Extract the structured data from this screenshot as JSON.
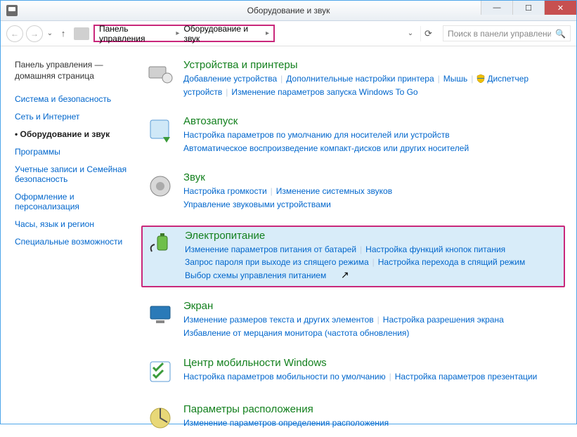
{
  "window": {
    "title": "Оборудование и звук",
    "search_placeholder": "Поиск в панели управления"
  },
  "breadcrumb": {
    "root": "Панель управления",
    "current": "Оборудование и звук"
  },
  "sidebar": {
    "home": "Панель управления — домашняя страница",
    "items": [
      {
        "label": "Система и безопасность",
        "current": false
      },
      {
        "label": "Сеть и Интернет",
        "current": false
      },
      {
        "label": "Оборудование и звук",
        "current": true
      },
      {
        "label": "Программы",
        "current": false
      },
      {
        "label": "Учетные записи и Семейная безопасность",
        "current": false
      },
      {
        "label": "Оформление и персонализация",
        "current": false
      },
      {
        "label": "Часы, язык и регион",
        "current": false
      },
      {
        "label": "Специальные возможности",
        "current": false
      }
    ]
  },
  "categories": [
    {
      "title": "Устройства и принтеры",
      "links": [
        "Добавление устройства",
        "Дополнительные настройки принтера",
        "Мышь",
        "_shield_Диспетчер устройств",
        "Изменение параметров запуска Windows To Go"
      ]
    },
    {
      "title": "Автозапуск",
      "links": [
        "Настройка параметров по умолчанию для носителей или устройств",
        "_br_Автоматическое воспроизведение компакт-дисков или других носителей"
      ]
    },
    {
      "title": "Звук",
      "links": [
        "Настройка громкости",
        "Изменение системных звуков",
        "_br_Управление звуковыми устройствами"
      ]
    },
    {
      "title": "Электропитание",
      "highlighted": true,
      "links": [
        "Изменение параметров питания от батарей",
        "Настройка функций кнопок питания",
        "_br_Запрос пароля при выходе из спящего режима",
        "Настройка перехода в спящий режим",
        "_br_Выбор схемы управления питанием"
      ]
    },
    {
      "title": "Экран",
      "links": [
        "Изменение размеров текста и других элементов",
        "Настройка разрешения экрана",
        "_br_Избавление от мерцания монитора (частота обновления)"
      ]
    },
    {
      "title": "Центр мобильности Windows",
      "links": [
        "Настройка параметров мобильности по умолчанию",
        "Настройка параметров презентации"
      ]
    },
    {
      "title": "Параметры расположения",
      "links": [
        "Изменение параметров определения расположения"
      ]
    }
  ]
}
